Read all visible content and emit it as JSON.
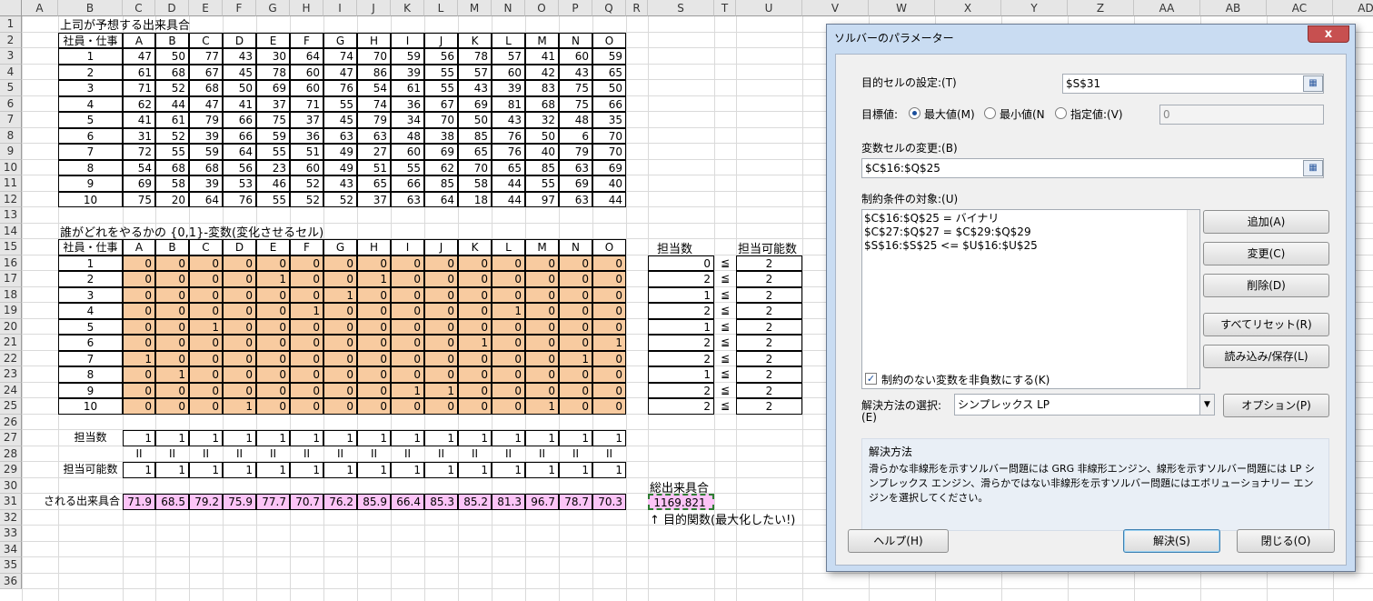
{
  "columns": [
    "A",
    "B",
    "C",
    "D",
    "E",
    "F",
    "G",
    "H",
    "I",
    "J",
    "K",
    "L",
    "M",
    "N",
    "O",
    "P",
    "Q",
    "R",
    "S",
    "T",
    "U",
    "V",
    "W",
    "X",
    "Y",
    "Z",
    "AA",
    "AB",
    "AC",
    "AD"
  ],
  "rows": [
    "1",
    "2",
    "3",
    "4",
    "5",
    "6",
    "7",
    "8",
    "9",
    "10",
    "11",
    "12",
    "13",
    "14",
    "15",
    "16",
    "17",
    "18",
    "19",
    "20",
    "21",
    "22",
    "23",
    "24",
    "25",
    "26",
    "27",
    "28",
    "29",
    "30",
    "31",
    "32",
    "33",
    "34",
    "35",
    "36"
  ],
  "sheet": {
    "section1_title": "上司が予想する出来具合",
    "header_label": "社員・仕事",
    "jobs": [
      "A",
      "B",
      "C",
      "D",
      "E",
      "F",
      "G",
      "H",
      "I",
      "J",
      "K",
      "L",
      "M",
      "N",
      "O"
    ],
    "employees": [
      "1",
      "2",
      "3",
      "4",
      "5",
      "6",
      "7",
      "8",
      "9",
      "10"
    ],
    "scores": [
      [
        "47",
        "50",
        "77",
        "43",
        "30",
        "64",
        "74",
        "70",
        "59",
        "56",
        "78",
        "57",
        "41",
        "60",
        "59"
      ],
      [
        "61",
        "68",
        "67",
        "45",
        "78",
        "60",
        "47",
        "86",
        "39",
        "55",
        "57",
        "60",
        "42",
        "43",
        "65"
      ],
      [
        "71",
        "52",
        "68",
        "50",
        "69",
        "60",
        "76",
        "54",
        "61",
        "55",
        "43",
        "39",
        "83",
        "75",
        "50"
      ],
      [
        "62",
        "44",
        "47",
        "41",
        "37",
        "71",
        "55",
        "74",
        "36",
        "67",
        "69",
        "81",
        "68",
        "75",
        "66"
      ],
      [
        "41",
        "61",
        "79",
        "66",
        "75",
        "37",
        "45",
        "79",
        "34",
        "70",
        "50",
        "43",
        "32",
        "48",
        "35"
      ],
      [
        "31",
        "52",
        "39",
        "66",
        "59",
        "36",
        "63",
        "63",
        "48",
        "38",
        "85",
        "76",
        "50",
        "6",
        "70"
      ],
      [
        "72",
        "55",
        "59",
        "64",
        "55",
        "51",
        "49",
        "27",
        "60",
        "69",
        "65",
        "76",
        "40",
        "79",
        "70"
      ],
      [
        "54",
        "68",
        "68",
        "56",
        "23",
        "60",
        "49",
        "51",
        "55",
        "62",
        "70",
        "65",
        "85",
        "63",
        "69"
      ],
      [
        "69",
        "58",
        "39",
        "53",
        "46",
        "52",
        "43",
        "65",
        "66",
        "85",
        "58",
        "44",
        "55",
        "69",
        "40"
      ],
      [
        "75",
        "20",
        "64",
        "76",
        "55",
        "52",
        "52",
        "37",
        "63",
        "64",
        "18",
        "44",
        "97",
        "63",
        "44"
      ]
    ],
    "section2_title": "誰がどれをやるかの {0,1}-変数(変化させるセル)",
    "assign": [
      [
        "0",
        "0",
        "0",
        "0",
        "0",
        "0",
        "0",
        "0",
        "0",
        "0",
        "0",
        "0",
        "0",
        "0",
        "0"
      ],
      [
        "0",
        "0",
        "0",
        "0",
        "1",
        "0",
        "0",
        "1",
        "0",
        "0",
        "0",
        "0",
        "0",
        "0",
        "0"
      ],
      [
        "0",
        "0",
        "0",
        "0",
        "0",
        "0",
        "1",
        "0",
        "0",
        "0",
        "0",
        "0",
        "0",
        "0",
        "0"
      ],
      [
        "0",
        "0",
        "0",
        "0",
        "0",
        "1",
        "0",
        "0",
        "0",
        "0",
        "0",
        "1",
        "0",
        "0",
        "0"
      ],
      [
        "0",
        "0",
        "1",
        "0",
        "0",
        "0",
        "0",
        "0",
        "0",
        "0",
        "0",
        "0",
        "0",
        "0",
        "0"
      ],
      [
        "0",
        "0",
        "0",
        "0",
        "0",
        "0",
        "0",
        "0",
        "0",
        "0",
        "1",
        "0",
        "0",
        "0",
        "1"
      ],
      [
        "1",
        "0",
        "0",
        "0",
        "0",
        "0",
        "0",
        "0",
        "0",
        "0",
        "0",
        "0",
        "0",
        "1",
        "0"
      ],
      [
        "0",
        "1",
        "0",
        "0",
        "0",
        "0",
        "0",
        "0",
        "0",
        "0",
        "0",
        "0",
        "0",
        "0",
        "0"
      ],
      [
        "0",
        "0",
        "0",
        "0",
        "0",
        "0",
        "0",
        "0",
        "1",
        "1",
        "0",
        "0",
        "0",
        "0",
        "0"
      ],
      [
        "0",
        "0",
        "0",
        "1",
        "0",
        "0",
        "0",
        "0",
        "0",
        "0",
        "0",
        "0",
        "1",
        "0",
        "0"
      ]
    ],
    "count_header": "担当数",
    "capacity_header": "担当可能数",
    "counts": [
      "0",
      "2",
      "1",
      "2",
      "1",
      "2",
      "2",
      "1",
      "2",
      "2"
    ],
    "leq_symbol": "≦",
    "capacities": [
      "2",
      "2",
      "2",
      "2",
      "2",
      "2",
      "2",
      "2",
      "2",
      "2"
    ],
    "row27_label": "担当数",
    "row27_values": [
      "1",
      "1",
      "1",
      "1",
      "1",
      "1",
      "1",
      "1",
      "1",
      "1",
      "1",
      "1",
      "1",
      "1",
      "1"
    ],
    "eq_symbol": "II",
    "row29_label": "担当可能数",
    "row29_values": [
      "1",
      "1",
      "1",
      "1",
      "1",
      "1",
      "1",
      "1",
      "1",
      "1",
      "1",
      "1",
      "1",
      "1",
      "1"
    ],
    "total_label": "総出来具合",
    "row31_label": "される出来具合",
    "row31_values": [
      "71.9",
      "68.5",
      "79.2",
      "75.9",
      "77.7",
      "70.7",
      "76.2",
      "85.9",
      "66.4",
      "85.3",
      "85.2",
      "81.3",
      "96.7",
      "78.7",
      "70.3"
    ],
    "total_value": "1169.821",
    "objective_note": "↑ 目的関数(最大化したい!)"
  },
  "dialog": {
    "title": "ソルバーのパラメーター",
    "close_glyph": "x",
    "objective_label": "目的セルの設定:(T)",
    "objective_value": "$S$31",
    "goal_label": "目標値:",
    "option_max": "最大値(M)",
    "option_min": "最小値(N",
    "option_value": "指定値:(V)",
    "value_field": "0",
    "variable_label": "変数セルの変更:(B)",
    "variable_value": "$C$16:$Q$25",
    "constraints_label": "制約条件の対象:(U)",
    "constraints": [
      "$C$16:$Q$25 = バイナリ",
      "$C$27:$Q$27 = $C$29:$Q$29",
      "$S$16:$S$25 <= $U$16:$U$25"
    ],
    "btn_add": "追加(A)",
    "btn_change": "変更(C)",
    "btn_delete": "削除(D)",
    "btn_reset": "すべてリセット(R)",
    "btn_load": "読み込み/保存(L)",
    "nonneg_label": "制約のない変数を非負数にする(K)",
    "method_label_line1": "解決方法の選択:",
    "method_label_line2": "(E)",
    "method_value": "シンプレックス LP",
    "btn_options": "オプション(P)",
    "method_box_title": "解決方法",
    "method_box_desc": "滑らかな非線形を示すソルバー問題には GRG 非線形エンジン、線形を示すソルバー問題には LP シンプレックス エンジン、滑らかではない非線形を示すソルバー問題にはエボリューショナリー エンジンを選択してください。",
    "btn_help": "ヘルプ(H)",
    "btn_solve": "解決(S)",
    "btn_close": "閉じる(O)"
  }
}
